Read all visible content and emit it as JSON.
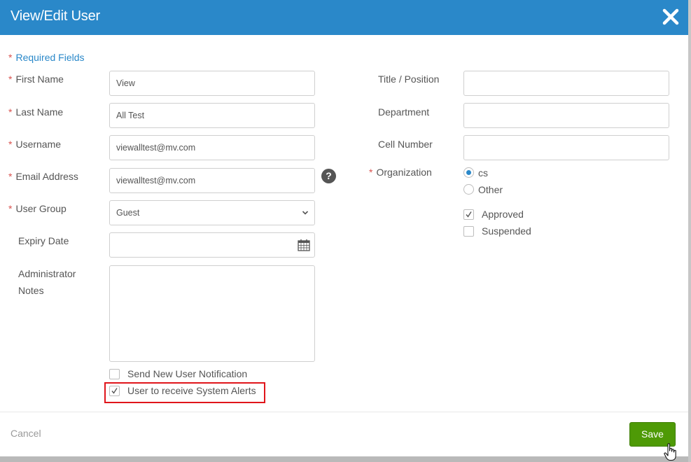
{
  "dialog": {
    "title": "View/Edit User",
    "required_marker": "*",
    "required_fields_label": "Required Fields"
  },
  "left_fields": {
    "first_name": {
      "label": "First Name",
      "value": "View"
    },
    "last_name": {
      "label": "Last Name",
      "value": "All Test"
    },
    "username": {
      "label": "Username",
      "value": "viewalltest@mv.com"
    },
    "email": {
      "label": "Email Address",
      "value": "viewalltest@mv.com",
      "help": "?"
    },
    "user_group": {
      "label": "User Group",
      "value": "Guest"
    },
    "expiry_date": {
      "label": "Expiry Date",
      "value": ""
    },
    "admin_notes": {
      "label_line1": "Administrator",
      "label_line2": "Notes",
      "value": ""
    }
  },
  "right_fields": {
    "title_position": {
      "label": "Title / Position",
      "value": ""
    },
    "department": {
      "label": "Department",
      "value": ""
    },
    "cell_number": {
      "label": "Cell Number",
      "value": ""
    },
    "organization": {
      "label": "Organization",
      "options": [
        {
          "label": "cs",
          "selected": true
        },
        {
          "label": "Other",
          "selected": false
        }
      ]
    },
    "status": [
      {
        "label": "Approved",
        "checked": true
      },
      {
        "label": "Suspended",
        "checked": false
      }
    ]
  },
  "notifications": [
    {
      "label": "Send New User Notification",
      "checked": false
    },
    {
      "label": "User to receive System Alerts",
      "checked": true,
      "highlighted": true
    }
  ],
  "footer": {
    "cancel_label": "Cancel",
    "save_label": "Save"
  },
  "colors": {
    "header": "#2a88c9",
    "required": "#d9534f",
    "link": "#2a88c9",
    "save": "#4e9a06",
    "highlight": "#e0151b"
  },
  "icons": [
    "close-icon",
    "chevron-down-icon",
    "calendar-icon",
    "help-icon",
    "checkmark-icon",
    "hand-cursor-icon"
  ]
}
